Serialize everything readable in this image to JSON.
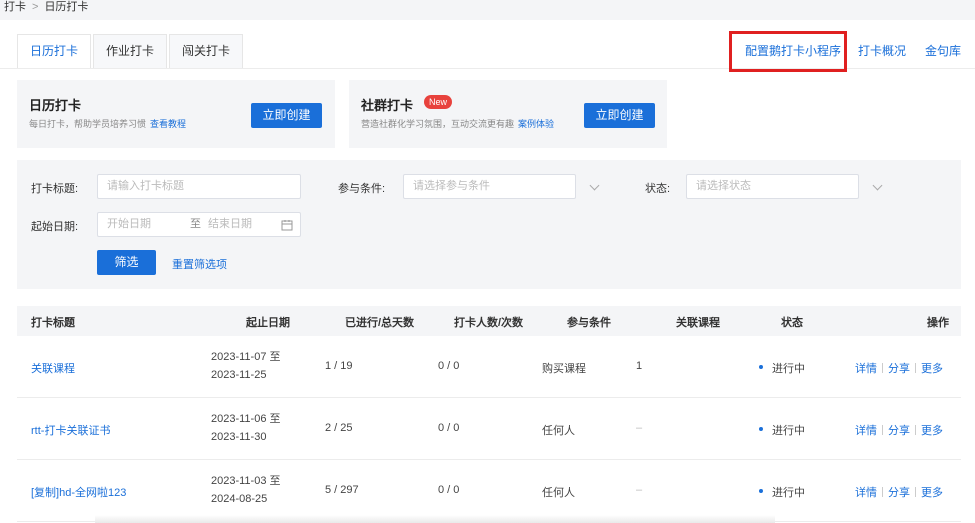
{
  "breadcrumb": {
    "parent": "打卡",
    "sep": ">",
    "current": "日历打卡"
  },
  "tabs": [
    {
      "label": "日历打卡",
      "active": true
    },
    {
      "label": "作业打卡",
      "active": false
    },
    {
      "label": "闯关打卡",
      "active": false
    }
  ],
  "top_links": {
    "config_mini": "配置鹅打卡小程序",
    "overview": "打卡概况",
    "quotes": "金句库"
  },
  "cards": [
    {
      "title": "日历打卡",
      "desc": "每日打卡，帮助学员培养习惯",
      "link": "查看教程",
      "button": "立即创建"
    },
    {
      "title": "社群打卡",
      "badge": "New",
      "desc": "营造社群化学习氛围，互动交流更有趣",
      "link": "案例体验",
      "button": "立即创建"
    }
  ],
  "filter": {
    "title_label": "打卡标题:",
    "title_placeholder": "请输入打卡标题",
    "cond_label": "参与条件:",
    "cond_placeholder": "请选择参与条件",
    "status_label": "状态:",
    "status_placeholder": "请选择状态",
    "date_label": "起始日期:",
    "start_placeholder": "开始日期",
    "to": "至",
    "end_placeholder": "结束日期",
    "filter_button": "筛选",
    "reset": "重置筛选项"
  },
  "table": {
    "headers": {
      "title": "打卡标题",
      "dates": "起止日期",
      "progress": "已进行/总天数",
      "count": "打卡人数/次数",
      "cond": "参与条件",
      "course": "关联课程",
      "status": "状态",
      "ops": "操作"
    },
    "rows": [
      {
        "title": "关联课程",
        "start": "2023-11-07 至",
        "end": "2023-11-25",
        "progress": "1 / 19",
        "count": "0 / 0",
        "cond": "购买课程",
        "course": "1",
        "status": "进行中"
      },
      {
        "title": "rtt-打卡关联证书",
        "start": "2023-11-06 至",
        "end": "2023-11-30",
        "progress": "2 / 25",
        "count": "0 / 0",
        "cond": "任何人",
        "course": "–",
        "status": "进行中"
      },
      {
        "title": "[复制]hd-全网啦123",
        "start": "2023-11-03 至",
        "end": "2024-08-25",
        "progress": "5 / 297",
        "count": "0 / 0",
        "cond": "任何人",
        "course": "–",
        "status": "进行中"
      }
    ],
    "ops": {
      "detail": "详情",
      "share": "分享",
      "more": "更多"
    }
  },
  "colors": {
    "accent": "#1a6fd9",
    "highlight_box": "#e02020",
    "badge": "#e8423d"
  }
}
